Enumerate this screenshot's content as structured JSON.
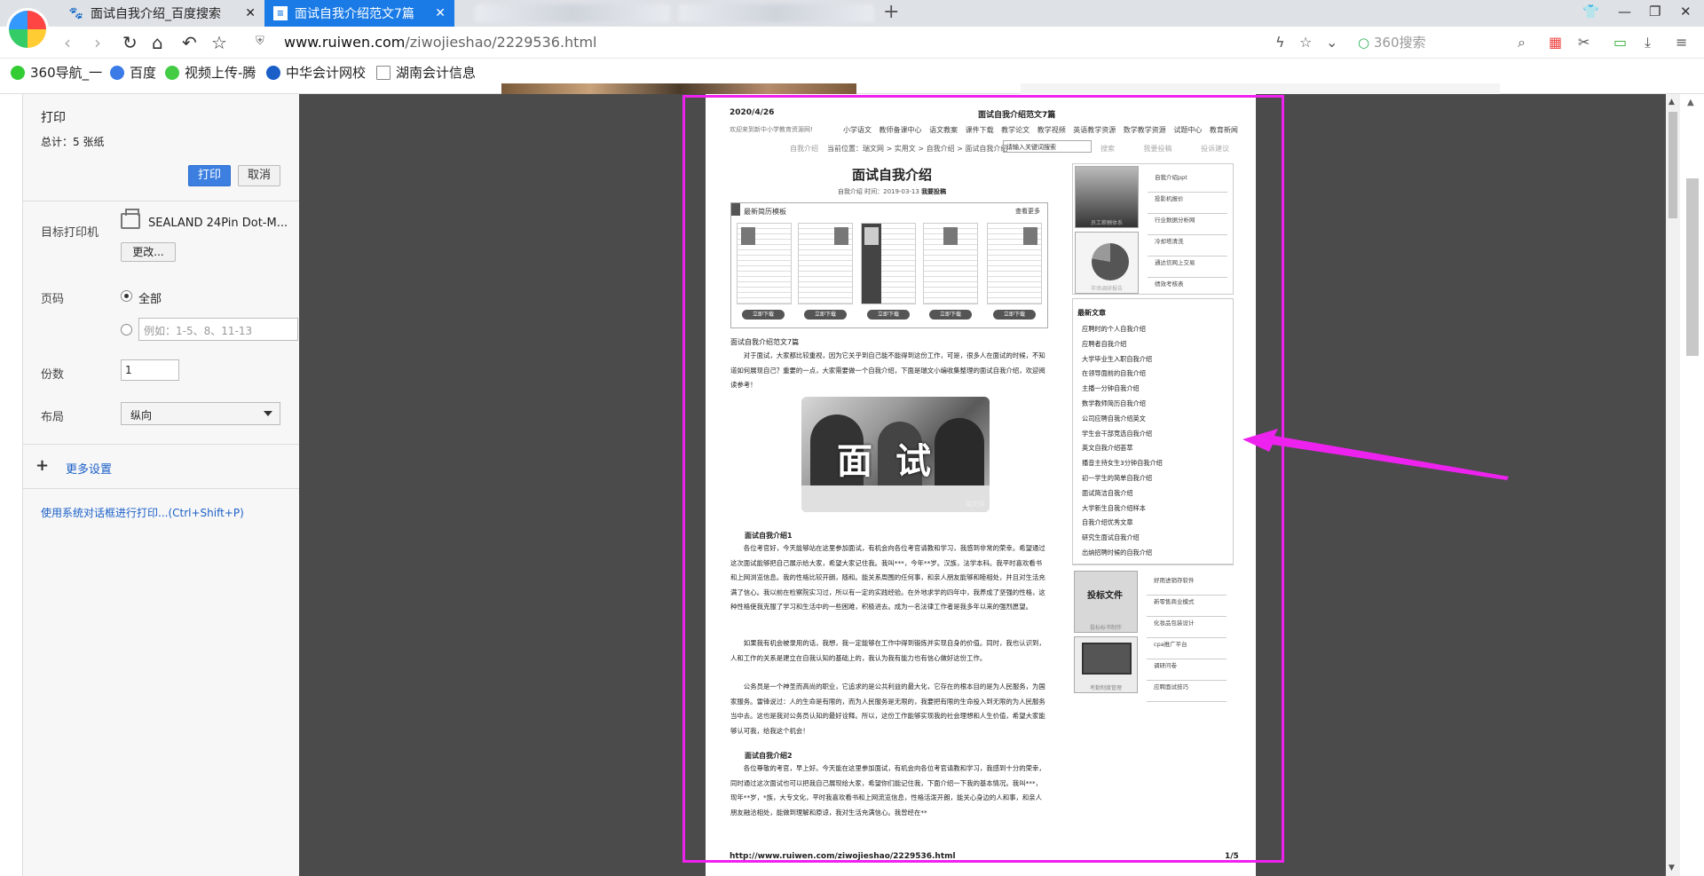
{
  "browser": {
    "tabs": [
      {
        "title": "面试自我介绍_百度搜索",
        "icon": "baidu-paw-icon"
      },
      {
        "title": "面试自我介绍范文7篇",
        "icon": "ruiwen-icon",
        "active": true
      }
    ],
    "new_tab_glyph": "+",
    "address": {
      "domain": "www.ruiwen.com",
      "path": "/ziwojieshao/2229536.html"
    },
    "search_placeholder": "360搜索",
    "bookmarks": [
      "360导航_一",
      "百度",
      "视频上传-腾",
      "中华会计网校",
      "湖南会计信息"
    ],
    "accent": "#1a7be6"
  },
  "print_panel": {
    "title": "打印",
    "total": "总计：5 张纸",
    "print_button": "打印",
    "cancel_button": "取消",
    "printer_label": "目标打印机",
    "printer_name": "SEALAND 24Pin Dot-M...",
    "change_button": "更改...",
    "pages_label": "页码",
    "pages_all": "全部",
    "pages_range_placeholder": "例如：1-5、8、11-13",
    "copies_label": "份数",
    "copies_value": "1",
    "layout_label": "布局",
    "layout_value": "纵向",
    "more_settings": "更多设置",
    "system_dialog": "使用系统对话框进行打印...(Ctrl+Shift+P)"
  },
  "preview": {
    "header_date": "2020/4/26",
    "header_title": "面试自我介绍范文7篇",
    "nav_welcome": "欢迎来到新中小学教育资源网!",
    "nav_links": "小学语文 教师备课中心 语文教案 课件下载 教学论文 教学视频 英语教学资源 数学教学资源 试题中心 教育新闻",
    "crumb_left": "自我介绍",
    "crumb": "当前位置：瑞文网 > 实用文 > 自我介绍 > 面试自我介绍",
    "site_search": "请输入关键词搜索",
    "top_links": "搜索 我要投稿 投诉建议",
    "article_title": "面试自我介绍",
    "article_meta_prefix": "自我介绍  时间：2019-03-13",
    "article_meta_bold": "我要投稿",
    "template_box": {
      "title": "最新简历模板",
      "more": "查看更多",
      "download": "立即下载"
    },
    "subtitle": "面试自我介绍范文7篇",
    "intro": "对于面试，大家都比较重视，因为它关乎到自己能不能得到这份工作，可是，很多人在面试的时候，不知道如何展现自己？重要的一点，大家需要做一个自我介绍，下面是瑞文小编收集整理的面试自我介绍，欢迎阅读参考！",
    "hero_word": "面试",
    "hero_watermark": "瑞文网",
    "sec1_title": "面试自我介绍1",
    "sec1_p1": "各位考官好，今天能够站在这里参加面试，有机会向各位考官请教和学习，我感到非常的荣幸。希望通过这次面试能够把自己展示给大家，希望大家记住我。我叫***，今年**岁。汉族，法学本科。我平时喜欢看书和上网浏览信息。我的性格比较开朗，随和。能关系周围的任何事，和亲人朋友能够和睦相处，并且对生活充满了信心。我以前在检察院实习过，所以有一定的实践经验。在外地求学的四年中，我养成了坚强的性格，这种性格使我克服了学习和生活中的一些困难，积极进去。成为一名法律工作者是我多年以来的强烈愿望。",
    "sec1_p2": "如果我有机会被录用的话，我想，我一定能够在工作中得到锻炼并实现自身的价值。同时，我也认识到，人和工作的关系是建立在自我认知的基础上的，我认为我有能力也有信心做好这份工作。",
    "sec1_p3": "公务员是一个神圣而高尚的职业，它追求的是公共利益的最大化，它存在的根本目的是为人民服务，为国家服务。雷锋说过：人的生命是有限的，而为人民服务是无限的，我要把有限的生命投入到无限的为人民服务当中去。这也是我对公务员认知的最好诠释。所以，这份工作能够实现我的社会理想和人生价值，希望大家能够认可我，给我这个机会！",
    "sec2_title": "面试自我介绍2",
    "sec2_p1": "各位尊敬的考官，早上好。今天能在这里参加面试，有机会向各位考官请教和学习，我感到十分的荣幸，同时通过这次面试也可以把我自己展现给大家，希望你们能记住我，下面介绍一下我的基本情况。我叫***，现年**岁，*族，大专文化，平时我喜欢看书和上网流览信息，性格活泼开朗，能关心身边的人和事，和亲人朋友融洽相处，能做到理解和原谅，我对生活充满信心。我曾经在**",
    "side_a_caption1": "员工薪酬体系",
    "side_a_caption2": "市场调研报告",
    "side_a_links": [
      "自我介绍ppt",
      "投影机报价",
      "行业数据分析网",
      "冷却塔清洗",
      "通达信网上交易",
      "绩效考核表"
    ],
    "latest_title": "最新文章",
    "latest_list": [
      "应聘时的个人自我介绍",
      "应聘者自我介绍",
      "大学毕业生入职自我介绍",
      "在领导面前的自我介绍",
      "主播一分钟自我介绍",
      "数学教师简历自我介绍",
      "公司应聘自我介绍英文",
      "学生会干部竞选自我介绍",
      "英文自我介绍荟萃",
      "播音主持女生3分钟自我介绍",
      "初一学生的简单自我介绍",
      "面试简洁自我介绍",
      "大学新生自我介绍样本",
      "自我介绍优秀文章",
      "研究生面试自我介绍",
      "出纳招聘时候的自我介绍"
    ],
    "side_c_thumb_text": "投标文件",
    "side_c_caption1": "投标标书制作",
    "side_c_caption2": "考勤制度管理",
    "side_c_links": [
      "好用进销存软件",
      "新零售商业模式",
      "化妆品包装设计",
      "cpa推广平台",
      "调研问卷",
      "应聘面试技巧"
    ],
    "footer_url": "http://www.ruiwen.com/ziwojieshao/2229536.html",
    "footer_page": "1/5"
  },
  "annotation": {
    "color": "#ee22ee"
  }
}
